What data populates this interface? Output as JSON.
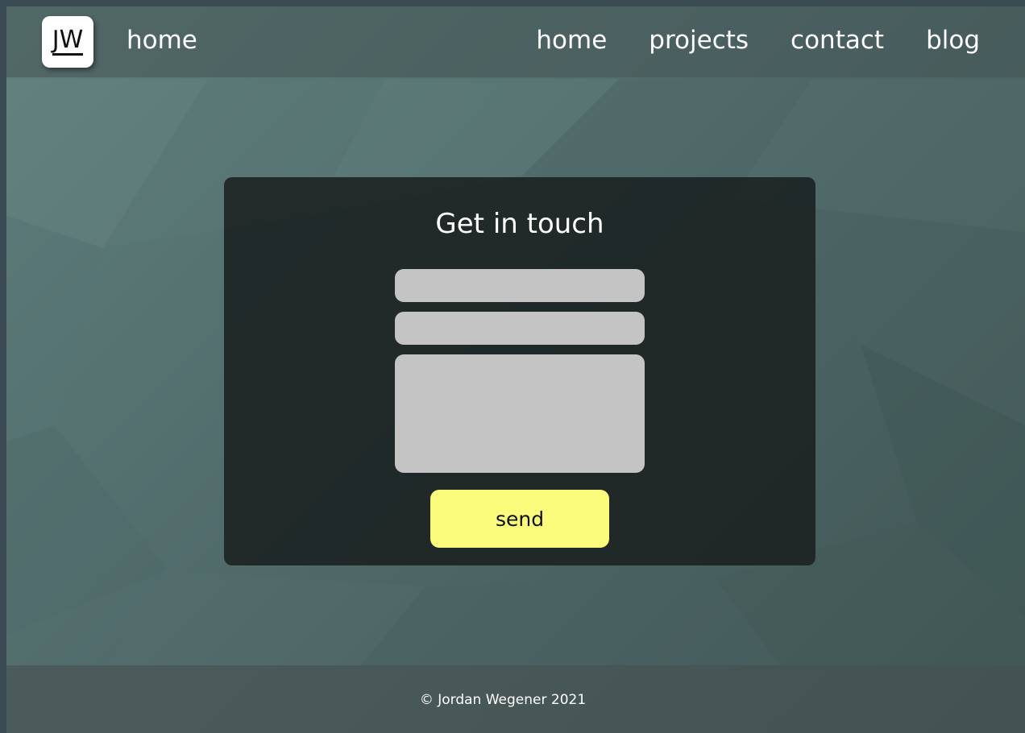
{
  "header": {
    "logo_text": "JW",
    "brand_link": "home",
    "nav": [
      {
        "label": "home"
      },
      {
        "label": "projects"
      },
      {
        "label": "contact"
      },
      {
        "label": "blog"
      }
    ]
  },
  "contact_form": {
    "title": "Get in touch",
    "name_value": "",
    "email_value": "",
    "message_value": "",
    "send_label": "send"
  },
  "footer": {
    "copyright": "© Jordan Wegener 2021"
  },
  "colors": {
    "button": "#fcfc7c",
    "field": "#c4c4c4",
    "card": "#1a2020"
  }
}
